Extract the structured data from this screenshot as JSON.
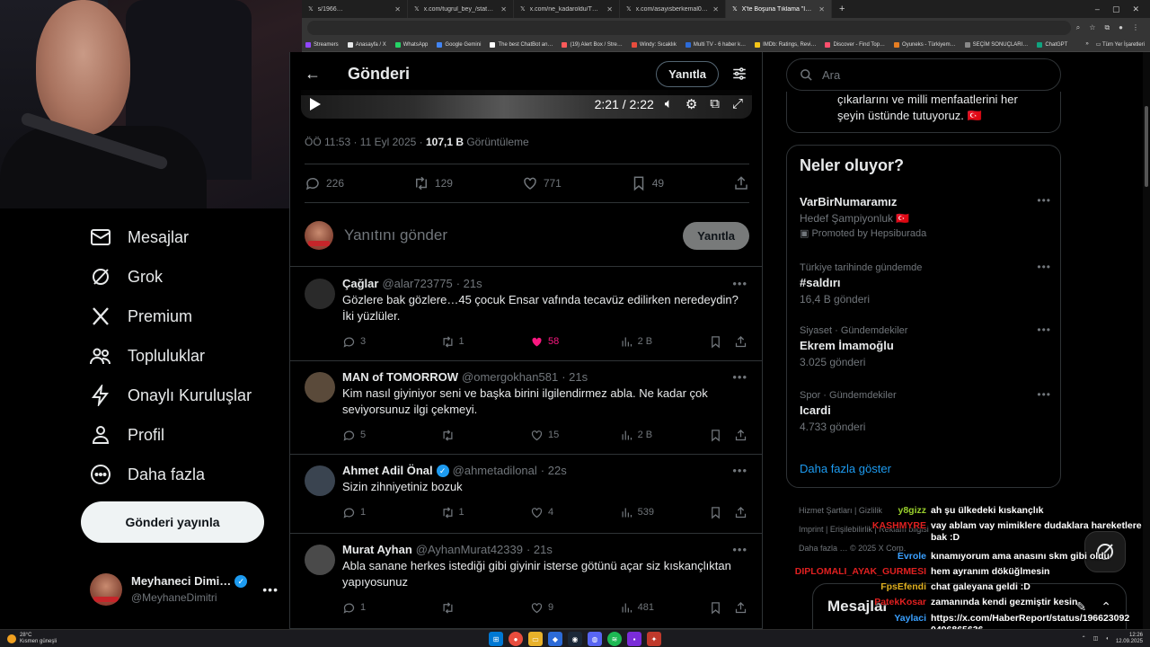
{
  "browser": {
    "tabs": [
      {
        "label": "s/1966…",
        "active": false
      },
      {
        "label": "x.com/tugrul_bey_/status/196…",
        "active": false
      },
      {
        "label": "x.com/ne_kadaroldu/TR/status/…",
        "active": false
      },
      {
        "label": "x.com/asayisberkemal0/status/…",
        "active": false
      },
      {
        "label": "X'te Boşuna Tıklama \"İstanbul\"…",
        "active": true
      }
    ],
    "bookmarks": [
      "Streamers",
      "Anasayfa / X",
      "WhatsApp",
      "Google Gemini",
      "The best ChatBot an…",
      "(19) Alert Box / Stre…",
      "Windy: Sıcaklık",
      "Multi TV - 6 haber k…",
      "IMDb: Ratings, Revi…",
      "Discover - Find Top…",
      "Oyuneks - Türkiyem…",
      "SEÇİM SONUÇLARI…",
      "ChatGPT"
    ],
    "bookmarks_folder": "Tüm Yer İşaretleri"
  },
  "nav": {
    "items": [
      {
        "label": "Mesajlar",
        "icon": "mail-icon"
      },
      {
        "label": "Grok",
        "icon": "grok-icon"
      },
      {
        "label": "Premium",
        "icon": "x-logo-icon"
      },
      {
        "label": "Topluluklar",
        "icon": "people-icon"
      },
      {
        "label": "Onaylı Kuruluşlar",
        "icon": "lightning-icon"
      },
      {
        "label": "Profil",
        "icon": "person-icon"
      },
      {
        "label": "Daha fazla",
        "icon": "more-circle-icon"
      }
    ],
    "post_button": "Gönderi yayınla",
    "account": {
      "name": "Meyhaneci Dimi…",
      "handle": "@MeyhaneDimitri"
    }
  },
  "main": {
    "title": "Gönderi",
    "reply_pill": "Yanıtla",
    "video_time": "2:21 / 2:22",
    "meta": {
      "time": "ÖÖ 11:53 · 11 Eyl 2025 · ",
      "views": "107,1 B",
      "views_label": " Görüntüleme"
    },
    "stats": {
      "replies": "226",
      "reposts": "129",
      "likes": "771",
      "bookmarks": "49"
    },
    "compose": {
      "placeholder": "Yanıtını gönder",
      "button": "Yanıtla"
    },
    "replies": [
      {
        "name": "Çağlar",
        "handle": "@alar723775",
        "time": "· 21s",
        "verified": false,
        "text": "Gözlere bak gözlere…45 çocuk Ensar vafında tecavüz edilirken neredeydin? İki yüzlüler.",
        "replies": "3",
        "reposts": "1",
        "likes": "58",
        "liked": true,
        "views": "2 B",
        "avatar_color": "#2a2a2a"
      },
      {
        "name": "MAN of TOMORROW",
        "handle": "@omergokhan581",
        "time": "· 21s",
        "verified": false,
        "text": "Kim nasıl giyiniyor seni ve başka birini ilgilendirmez abla. Ne kadar çok seviyorsunuz ilgi çekmeyi.",
        "replies": "5",
        "reposts": "",
        "likes": "15",
        "liked": false,
        "views": "2 B",
        "avatar_color": "#5a4a3a"
      },
      {
        "name": "Ahmet Adil Önal",
        "handle": "@ahmetadilonal",
        "time": "· 22s",
        "verified": true,
        "text": "Sizin zihniyetiniz bozuk",
        "replies": "1",
        "reposts": "1",
        "likes": "4",
        "liked": false,
        "views": "539",
        "avatar_color": "#3a4450"
      },
      {
        "name": "Murat Ayhan",
        "handle": "@AyhanMurat42339",
        "time": "· 21s",
        "verified": false,
        "text": "Abla sanane herkes istediği gibi giyinir isterse götünü açar siz kıskançlıktan yapıyosunuz",
        "replies": "1",
        "reposts": "",
        "likes": "9",
        "liked": false,
        "views": "481",
        "avatar_color": "#4a4a4a"
      }
    ]
  },
  "right": {
    "search_placeholder": "Ara",
    "prev_card_text": "çıkarlarını ve milli menfaatlerini her şeyin üstünde tutuyoruz. 🇹🇷",
    "trends_title": "Neler oluyor?",
    "trends": [
      {
        "small": "",
        "big": "VarBirNumaramız",
        "sub": "Hedef Şampiyonluk 🇹🇷",
        "promo": "Promoted by Hepsiburada"
      },
      {
        "small": "Türkiye tarihinde gündemde",
        "big": "#saldırı",
        "sub": "16,4 B gönderi",
        "promo": ""
      },
      {
        "small": "Siyaset · Gündemdekiler",
        "big": "Ekrem İmamoğlu",
        "sub": "3.025 gönderi",
        "promo": ""
      },
      {
        "small": "Spor · Gündemdekiler",
        "big": "Icardi",
        "sub": "4.733 gönderi",
        "promo": ""
      }
    ],
    "show_more": "Daha fazla göster",
    "footer": {
      "l1": "Hizmet Şartları  |  Gizlilik",
      "l2": "Imprint  |  Erişilebilirlik  |  Reklam bilgisi",
      "l3": "Daha fazla …  © 2025 X Corp."
    },
    "messages_drawer": "Mesajlar"
  },
  "chat": [
    {
      "user": "y8gizz",
      "color": "#9ad12c",
      "msg": "ah şu ülkedeki kıskançlık"
    },
    {
      "user": "KASHMYRE",
      "color": "#e02020",
      "msg": "vay ablam vay mimiklere dudaklara hareketlere bak :D"
    },
    {
      "user": "Evrole",
      "color": "#3aa0ff",
      "msg": "kınamıyorum ama anasını skm gibi oldu"
    },
    {
      "user": "DIPLOMALI_AYAK_GURMESI",
      "color": "#e02020",
      "msg": "hem ayranım döküğlmesin"
    },
    {
      "user": "FpsEfendi",
      "color": "#e0b020",
      "msg": "chat galeyana geldi :D"
    },
    {
      "user": "PatekKosar",
      "color": "#e02020",
      "msg": "zamanında kendi gezmiştir kesin"
    },
    {
      "user": "Yaylaci",
      "color": "#3aa0ff",
      "msg": "https://x.com/HaberReport/status/196623092 0496865636"
    }
  ],
  "taskbar": {
    "temp": "28°C",
    "weather": "Kısmen güneşli",
    "time": "12:26",
    "date": "12.09.2025"
  },
  "colors": {
    "accent": "#1d9bf0",
    "like": "#f91880",
    "border": "#2f3336",
    "muted": "#71767b"
  }
}
